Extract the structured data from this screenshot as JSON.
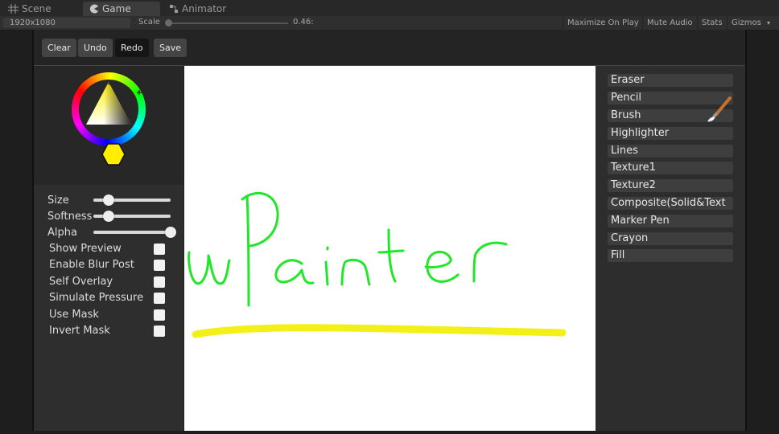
{
  "editor": {
    "tabs": [
      {
        "label": "Scene",
        "icon": "grid-icon"
      },
      {
        "label": "Game",
        "icon": "pacman-icon",
        "active": true
      },
      {
        "label": "Animator",
        "icon": "animator-icon"
      }
    ]
  },
  "gamebar": {
    "resolution": "1920x1080",
    "scale_label": "Scale",
    "scale_value": "0.46:",
    "scale_fraction": 0.02,
    "buttons": [
      "Maximize On Play",
      "Mute Audio",
      "Stats",
      "Gizmos"
    ]
  },
  "toolbar": {
    "clear": "Clear",
    "undo": "Undo",
    "redo": "Redo",
    "save": "Save"
  },
  "colors": {
    "selected_color": "#ffee00",
    "stroke_text": "#22e629",
    "stroke_line": "#f2ee00",
    "canvas_bg": "#ffffff"
  },
  "options": {
    "size_label": "Size",
    "softness_label": "Softness",
    "alpha_label": "Alpha",
    "size_value": 0.2,
    "softness_value": 0.2,
    "alpha_value": 1.0,
    "toggles": [
      {
        "label": "Show Preview",
        "checked": false
      },
      {
        "label": "Enable Blur Post",
        "checked": false
      },
      {
        "label": "Self Overlay",
        "checked": false
      },
      {
        "label": "Simulate Pressure",
        "checked": false
      },
      {
        "label": "Use Mask",
        "checked": false
      },
      {
        "label": "Invert Mask",
        "checked": false
      }
    ]
  },
  "tools": {
    "items": [
      {
        "label": "Eraser"
      },
      {
        "label": "Pencil"
      },
      {
        "label": "Brush",
        "selected": true,
        "icon": "paintbrush-icon"
      },
      {
        "label": "Highlighter"
      },
      {
        "label": "Lines"
      },
      {
        "label": "Texture1"
      },
      {
        "label": "Texture2"
      },
      {
        "label": "Composite(Solid&Text"
      },
      {
        "label": "Marker Pen"
      },
      {
        "label": "Crayon"
      },
      {
        "label": "Fill"
      }
    ]
  }
}
